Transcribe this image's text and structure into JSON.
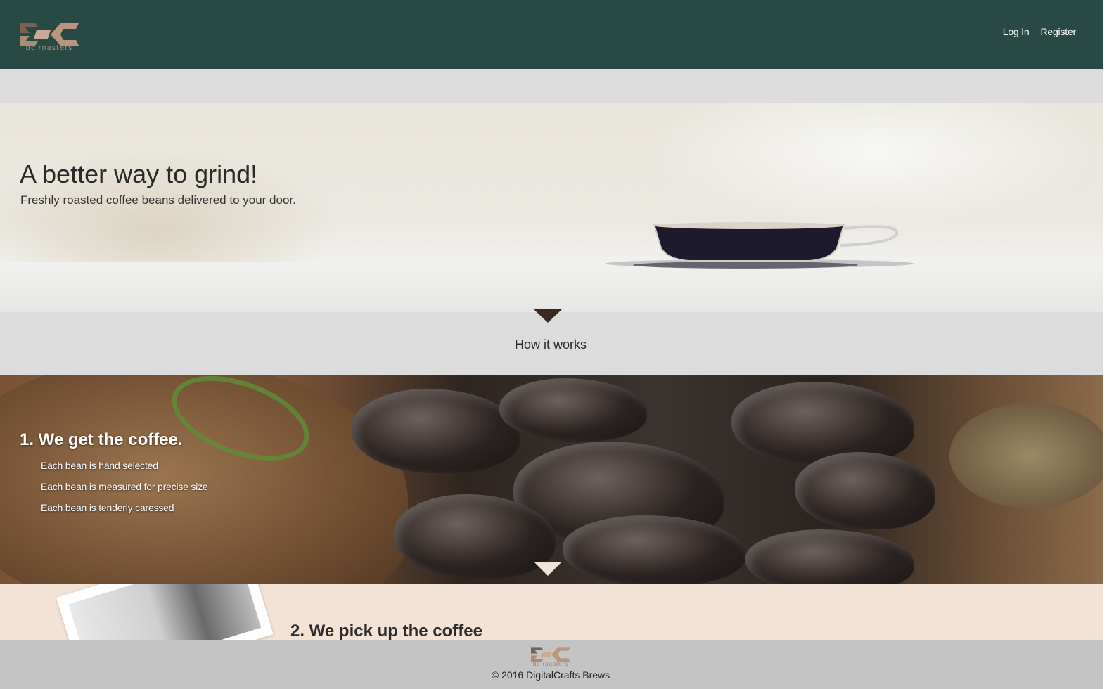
{
  "brand": {
    "logo_text": "dc roasters",
    "header_bg": "#294a44"
  },
  "nav": {
    "login": "Log In",
    "register": "Register"
  },
  "hero": {
    "title": "A better way to grind!",
    "subtitle": "Freshly roasted coffee beans delivered to your door."
  },
  "how_it_works": {
    "label": "How it works"
  },
  "step1": {
    "title": "1. We get the coffee.",
    "items": [
      "Each bean is hand selected",
      "Each bean is measured for precise size",
      "Each bean is tenderly caressed"
    ]
  },
  "step2": {
    "title": "2. We pick up the coffee"
  },
  "footer": {
    "logo_text": "dc roasters",
    "copyright": "© 2016 DigitalCrafts Brews"
  }
}
